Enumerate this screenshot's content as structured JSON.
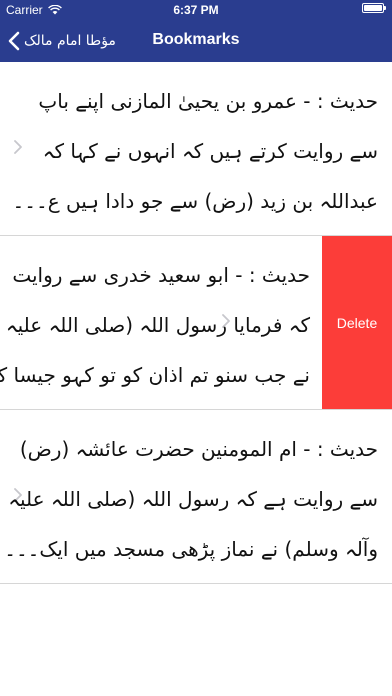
{
  "status_bar": {
    "carrier": "Carrier",
    "time": "6:37 PM"
  },
  "nav": {
    "back_label": "مؤطا امام مالک",
    "title": "Bookmarks"
  },
  "rows": [
    {
      "lines": [
        "حدیث : - عمرو بن یحییٰ المازنی اپنے باپ",
        "سے روایت کرتے ہیں کہ انہوں نے کہا کہ",
        "عبداللہ بن زید (رض) سے جو دادا ہیں ع۔۔۔"
      ]
    },
    {
      "lines": [
        "حدیث : - ابو سعید خدری سے روایت",
        "کہ فرمایا رسول اللہ (صلی اللہ علیہ وآلہ",
        "نے جب سنو تم اذان کو تو کہو جیسا کہ"
      ],
      "delete_label": "Delete"
    },
    {
      "lines": [
        "حدیث : - ام المومنین حضرت عائشہ (رض)",
        "سے روایت ہے کہ رسول اللہ (صلی اللہ علیہ",
        "وآلہ وسلم) نے نماز پڑھی مسجد میں ایک۔۔۔"
      ]
    }
  ],
  "colors": {
    "nav_bg": "#2a3d8f",
    "delete_bg": "#fc3d39"
  },
  "icons": {
    "back": "chevron-left-icon",
    "row": "chevron-right-icon"
  }
}
